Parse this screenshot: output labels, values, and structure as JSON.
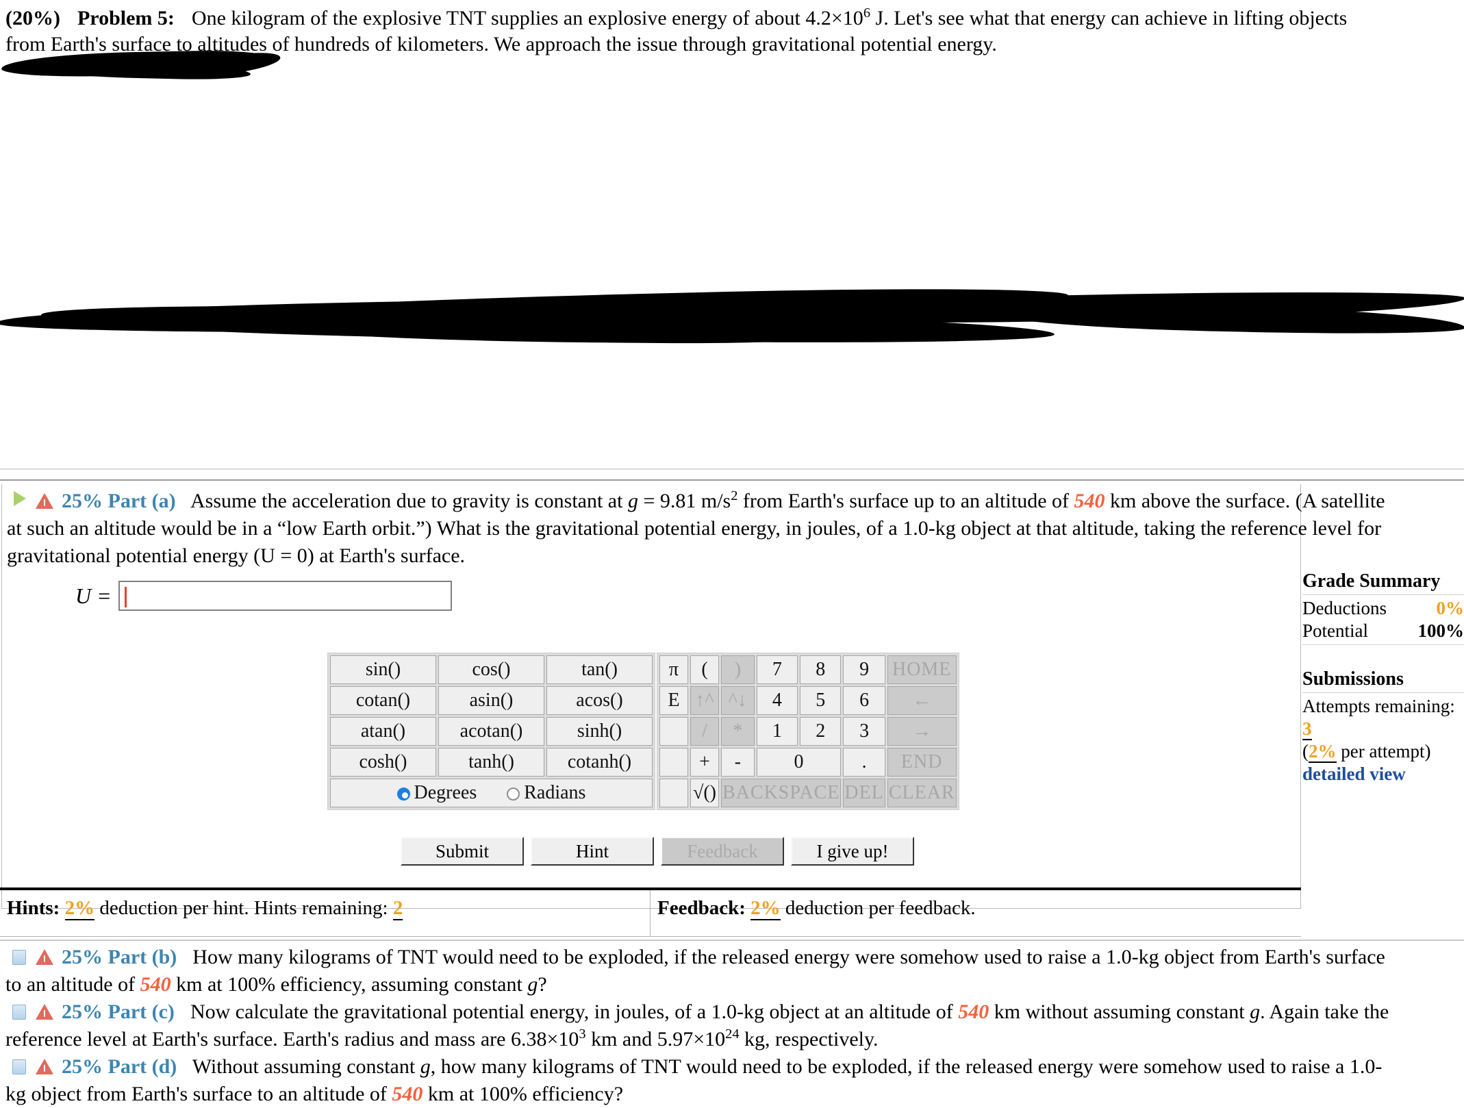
{
  "problem": {
    "weight": "(20%)",
    "title": "Problem 5:",
    "line1_a": "One kilogram of the explosive TNT supplies an explosive energy of about 4.2×10",
    "line1_exp": "6",
    "line1_b": " J. Let's see what that energy can achieve in lifting objects",
    "line2": "from Earth's surface to altitudes of hundreds of kilometers. We approach the issue through gravitational potential energy."
  },
  "redacted": {
    "url_ghost": "Physics_Multiparts.html  http://www.undelandphysics.edu"
  },
  "part_a": {
    "percent": "25%",
    "label": "Part (a)",
    "text_1": "Assume the acceleration due to gravity is constant at ",
    "var_g": "g",
    "text_2": " = 9.81 m/s",
    "exp_2": "2",
    "text_3": " from Earth's surface up to an altitude of ",
    "altitude": "540",
    "text_4": " km above the surface. (A satellite",
    "text_5": "at such an altitude would be in a “low Earth orbit.”) What is the gravitational potential energy, in joules, of a 1.0-kg object at that altitude, taking the reference level for",
    "text_6": "gravitational potential energy (U = 0) at Earth's surface.",
    "answer_label": "U =",
    "answer_value": "",
    "answer_placeholder": ""
  },
  "calculator": {
    "functions": [
      [
        "sin()",
        "cos()",
        "tan()"
      ],
      [
        "cotan()",
        "asin()",
        "acos()"
      ],
      [
        "atan()",
        "acotan()",
        "sinh()"
      ],
      [
        "cosh()",
        "tanh()",
        "cotanh()"
      ]
    ],
    "angle_mode": {
      "degrees": "Degrees",
      "radians": "Radians",
      "selected": "Degrees"
    },
    "keypad": [
      [
        {
          "label": "π",
          "state": "on",
          "w": "sm"
        },
        {
          "label": "(",
          "state": "on",
          "w": "sm"
        },
        {
          "label": ")",
          "state": "off",
          "w": "sm"
        },
        {
          "label": "7",
          "state": "on",
          "w": "md"
        },
        {
          "label": "8",
          "state": "on",
          "w": "md"
        },
        {
          "label": "9",
          "state": "on",
          "w": "md"
        },
        {
          "label": "HOME",
          "state": "off",
          "w": "lg",
          "small": true
        }
      ],
      [
        {
          "label": "E",
          "state": "on",
          "w": "sm"
        },
        {
          "label": "↑^",
          "state": "off",
          "w": "sm"
        },
        {
          "label": "^↓",
          "state": "off",
          "w": "sm"
        },
        {
          "label": "4",
          "state": "on",
          "w": "md"
        },
        {
          "label": "5",
          "state": "on",
          "w": "md"
        },
        {
          "label": "6",
          "state": "on",
          "w": "md"
        },
        {
          "label": "←",
          "state": "off",
          "w": "lg"
        }
      ],
      [
        {
          "label": "",
          "state": "on",
          "w": "sm"
        },
        {
          "label": "/",
          "state": "off",
          "w": "sm"
        },
        {
          "label": "*",
          "state": "off",
          "w": "sm"
        },
        {
          "label": "1",
          "state": "on",
          "w": "md"
        },
        {
          "label": "2",
          "state": "on",
          "w": "md"
        },
        {
          "label": "3",
          "state": "on",
          "w": "md"
        },
        {
          "label": "→",
          "state": "off",
          "w": "lg"
        }
      ],
      [
        {
          "label": "",
          "state": "on",
          "w": "sm"
        },
        {
          "label": "+",
          "state": "on",
          "w": "sm"
        },
        {
          "label": "-",
          "state": "on",
          "w": "sm"
        },
        {
          "label": "0",
          "state": "on",
          "w": "lg"
        },
        {
          "label": ".",
          "state": "on",
          "w": "md"
        },
        {
          "label": "END",
          "state": "off",
          "w": "lg",
          "small": true
        }
      ],
      [
        {
          "label": "",
          "state": "on",
          "w": "sm"
        },
        {
          "label": "√()",
          "state": "on",
          "w": "sm"
        },
        {
          "label": "BACKSPACE",
          "state": "off",
          "w": "bsp",
          "small": true
        },
        {
          "label": "DEL",
          "state": "off",
          "w": "md",
          "xsmall": true
        },
        {
          "label": "CLEAR",
          "state": "off",
          "w": "lg",
          "small": true
        }
      ]
    ]
  },
  "actions": {
    "submit": "Submit",
    "hint": "Hint",
    "feedback": "Feedback",
    "give_up": "I give up!"
  },
  "hints_bar": {
    "hints_label": "Hints:",
    "hints_pct": "2%",
    "hints_text": "deduction per hint. Hints remaining:",
    "hints_remaining": "2",
    "feedback_label": "Feedback:",
    "feedback_pct": "2%",
    "feedback_text": "deduction per feedback."
  },
  "grade_summary": {
    "title": "Grade Summary",
    "deductions_label": "Deductions",
    "deductions_value": "0%",
    "potential_label": "Potential",
    "potential_value": "100%",
    "submissions_title": "Submissions",
    "attempts_label": "Attempts remaining:",
    "attempts_value": "3",
    "per_attempt_open": "(",
    "per_attempt_pct": "2%",
    "per_attempt_text": " per attempt)",
    "detailed_view": "detailed view"
  },
  "part_b": {
    "percent": "25%",
    "label": "Part (b)",
    "text_1": "How many kilograms of TNT would need to be exploded, if the released energy were somehow used to raise a 1.0-kg object from Earth's surface",
    "text_2a": "to an altitude of ",
    "altitude": "540",
    "text_2b": " km at 100% efficiency, assuming constant ",
    "var_g": "g",
    "text_2c": "?"
  },
  "part_c": {
    "percent": "25%",
    "label": "Part (c)",
    "text_1a": "Now calculate the gravitational potential energy, in joules, of a 1.0-kg object at an altitude of ",
    "altitude": "540",
    "text_1b": " km without assuming constant ",
    "var_g": "g",
    "text_1c": ". Again take the",
    "text_2a": "reference level at Earth's surface. Earth's radius and mass are 6.38×10",
    "exp_r": "3",
    "text_2b": " km and 5.97×10",
    "exp_m": "24",
    "text_2c": " kg, respectively."
  },
  "part_d": {
    "percent": "25%",
    "label": "Part (d)",
    "text_1a": "Without assuming constant ",
    "var_g": "g",
    "text_1b": ", how many kilograms of TNT would need to be exploded, if the released energy were somehow used to raise a 1.0-",
    "text_2a": "kg object from Earth's surface to an altitude of ",
    "altitude": "540",
    "text_2b": " km at 100% efficiency?"
  },
  "colors": {
    "part_label": "#3d85b0",
    "hot_value": "#f4613c",
    "orange": "#f0a022",
    "link": "#1f4e9c",
    "warn": "#e06a5c",
    "green": "#a9d06a"
  }
}
